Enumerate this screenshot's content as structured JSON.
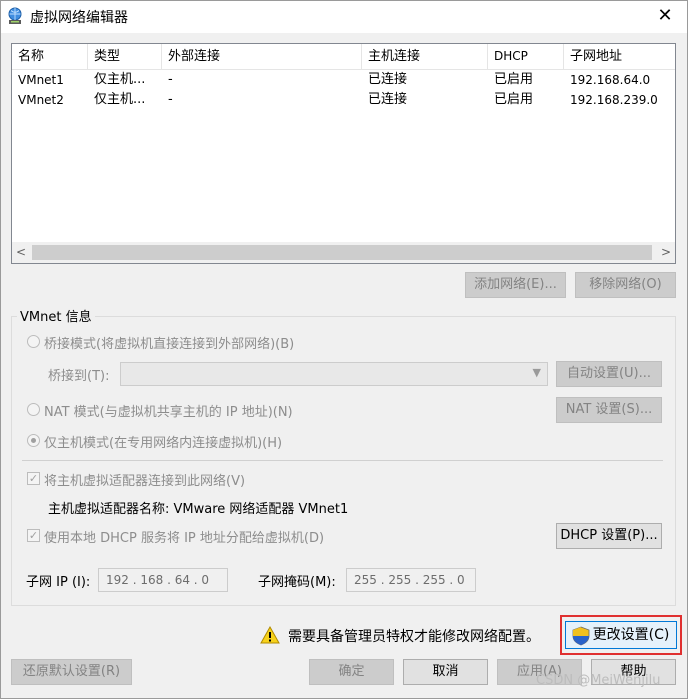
{
  "window": {
    "title": "虚拟网络编辑器",
    "close_glyph": "✕"
  },
  "table": {
    "columns": [
      "名称",
      "类型",
      "外部连接",
      "主机连接",
      "DHCP",
      "子网地址"
    ],
    "rows": [
      [
        "VMnet1",
        "仅主机...",
        "-",
        "已连接",
        "已启用",
        "192.168.64.0"
      ],
      [
        "VMnet2",
        "仅主机...",
        "-",
        "已连接",
        "已启用",
        "192.168.239.0"
      ]
    ],
    "scroll_left": "<",
    "scroll_right": ">"
  },
  "list_buttons": {
    "add": "添加网络(E)...",
    "remove": "移除网络(O)"
  },
  "vmnet_info": {
    "label": "VMnet 信息",
    "bridged": "桥接模式(将虚拟机直接连接到外部网络)(B)",
    "bridge_to": "桥接到(T):",
    "auto_settings": "自动设置(U)...",
    "nat": "NAT 模式(与虚拟机共享主机的 IP 地址)(N)",
    "nat_settings": "NAT 设置(S)...",
    "host_only": "仅主机模式(在专用网络内连接虚拟机)(H)",
    "connect_adapter": "将主机虚拟适配器连接到此网络(V)",
    "adapter_name": "主机虚拟适配器名称: VMware 网络适配器 VMnet1",
    "use_dhcp": "使用本地 DHCP 服务将 IP 地址分配给虚拟机(D)",
    "dhcp_settings": "DHCP 设置(P)...",
    "subnet_ip_label": "子网 IP (I):",
    "subnet_ip": "192 . 168 . 64 . 0",
    "subnet_mask_label": "子网掩码(M):",
    "subnet_mask": "255 . 255 . 255 . 0"
  },
  "admin": {
    "warning": "需要具备管理员特权才能修改网络配置。",
    "change": "更改设置(C)"
  },
  "footer": {
    "restore": "还原默认设置(R)",
    "ok": "确定",
    "cancel": "取消",
    "apply": "应用(A)",
    "help": "帮助"
  },
  "watermark": "CSDN @MeiWenjilu",
  "colors": {
    "highlight": "#e03030",
    "shield_blue": "#2a62c9",
    "shield_yellow": "#f2c01e",
    "warning_yellow": "#f7d21b"
  }
}
